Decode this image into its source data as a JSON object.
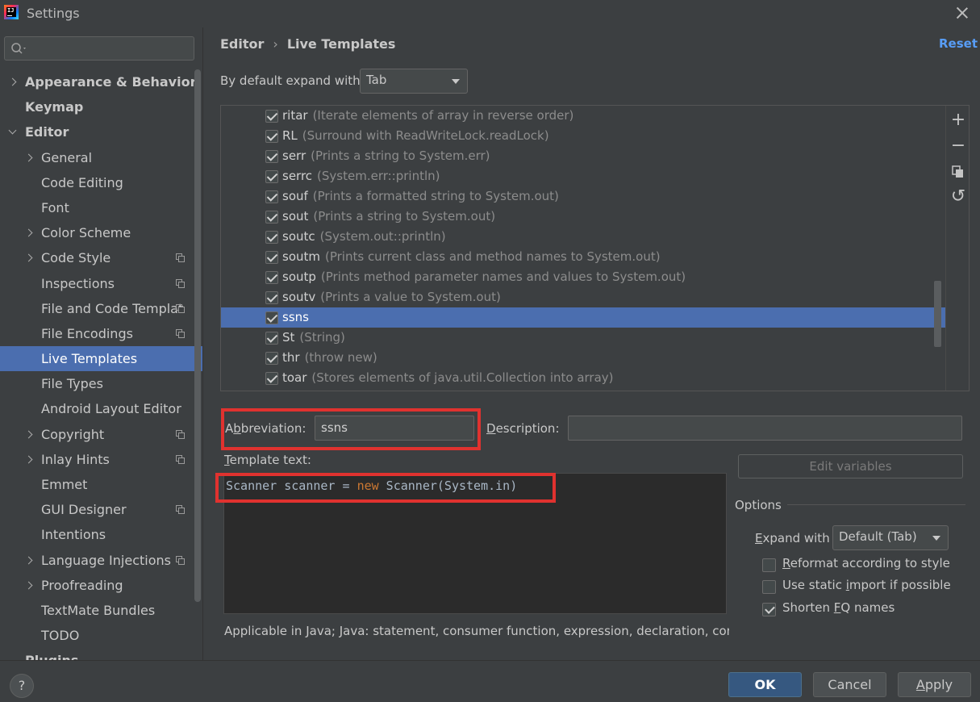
{
  "window": {
    "title": "Settings",
    "app_icon_text": "IJ"
  },
  "sidebar": {
    "search_placeholder": "",
    "items": [
      {
        "label": "Appearance & Behavior",
        "level": 0,
        "expandable": true,
        "expanded": false
      },
      {
        "label": "Keymap",
        "level": 0
      },
      {
        "label": "Editor",
        "level": 0,
        "expandable": true,
        "expanded": true
      },
      {
        "label": "General",
        "level": 1,
        "expandable": true
      },
      {
        "label": "Code Editing",
        "level": 1
      },
      {
        "label": "Font",
        "level": 1
      },
      {
        "label": "Color Scheme",
        "level": 1,
        "expandable": true
      },
      {
        "label": "Code Style",
        "level": 1,
        "expandable": true,
        "project_icon": true
      },
      {
        "label": "Inspections",
        "level": 1,
        "project_icon": true
      },
      {
        "label": "File and Code Templat",
        "level": 1,
        "project_icon": true
      },
      {
        "label": "File Encodings",
        "level": 1,
        "project_icon": true
      },
      {
        "label": "Live Templates",
        "level": 1,
        "selected": true
      },
      {
        "label": "File Types",
        "level": 1
      },
      {
        "label": "Android Layout Editor",
        "level": 1
      },
      {
        "label": "Copyright",
        "level": 1,
        "expandable": true,
        "project_icon": true
      },
      {
        "label": "Inlay Hints",
        "level": 1,
        "expandable": true,
        "project_icon": true
      },
      {
        "label": "Emmet",
        "level": 1
      },
      {
        "label": "GUI Designer",
        "level": 1,
        "project_icon": true
      },
      {
        "label": "Intentions",
        "level": 1
      },
      {
        "label": "Language Injections",
        "level": 1,
        "expandable": true,
        "project_icon": true
      },
      {
        "label": "Proofreading",
        "level": 1,
        "expandable": true
      },
      {
        "label": "TextMate Bundles",
        "level": 1
      },
      {
        "label": "TODO",
        "level": 1
      }
    ],
    "partial_item": "Plugins"
  },
  "breadcrumb": {
    "parent": "Editor",
    "separator": "›",
    "current": "Live Templates"
  },
  "reset_label": "Reset",
  "expand_with": {
    "label": "By default expand with",
    "value": "Tab"
  },
  "templates": [
    {
      "abbr": "ritar",
      "desc": "(Iterate elements of array in reverse order)",
      "checked": true
    },
    {
      "abbr": "RL",
      "desc": "(Surround with ReadWriteLock.readLock)",
      "checked": true
    },
    {
      "abbr": "serr",
      "desc": "(Prints a string to System.err)",
      "checked": true
    },
    {
      "abbr": "serrc",
      "desc": "(System.err::println)",
      "checked": true
    },
    {
      "abbr": "souf",
      "desc": "(Prints a formatted string to System.out)",
      "checked": true
    },
    {
      "abbr": "sout",
      "desc": "(Prints a string to System.out)",
      "checked": true
    },
    {
      "abbr": "soutc",
      "desc": "(System.out::println)",
      "checked": true
    },
    {
      "abbr": "soutm",
      "desc": "(Prints current class and method names to System.out)",
      "checked": true
    },
    {
      "abbr": "soutp",
      "desc": "(Prints method parameter names and values to System.out)",
      "checked": true
    },
    {
      "abbr": "soutv",
      "desc": "(Prints a value to System.out)",
      "checked": true
    },
    {
      "abbr": "ssns",
      "desc": "",
      "checked": true,
      "selected": true
    },
    {
      "abbr": "St",
      "desc": "(String)",
      "checked": true
    },
    {
      "abbr": "thr",
      "desc": "(throw new)",
      "checked": true
    },
    {
      "abbr": "toar",
      "desc": "(Stores elements of java.util.Collection into array)",
      "checked": true
    }
  ],
  "toolbar": {
    "add": "+",
    "remove": "−",
    "copy": "copy",
    "restore": "↺"
  },
  "abbreviation": {
    "label_pre": "A",
    "label_u": "b",
    "label_post": "breviation:",
    "value": "ssns"
  },
  "description": {
    "label_u": "D",
    "label_post": "escription:",
    "value": ""
  },
  "template_text": {
    "label_u": "T",
    "label_post": "emplate text:",
    "code_pre": "Scanner scanner = ",
    "code_kw": "new",
    "code_post": " Scanner(System.in)"
  },
  "edit_variables_label": "Edit variables",
  "options": {
    "title": "Options",
    "expand_with_label_u": "E",
    "expand_with_label_post": "xpand with",
    "expand_with_value": "Default (Tab)",
    "checkboxes": [
      {
        "label_pre": "",
        "label_u": "R",
        "label_post": "eformat according to style",
        "checked": false
      },
      {
        "label_pre": "Use static ",
        "label_u": "i",
        "label_post": "mport if possible",
        "checked": false
      },
      {
        "label_pre": "Shorten ",
        "label_u": "F",
        "label_post": "Q names",
        "checked": true
      }
    ]
  },
  "applicable_text": "Applicable in Java; Java: statement, consumer function, expression, declaration, comm",
  "footer": {
    "help": "?",
    "ok": "OK",
    "cancel": "Cancel",
    "apply_u": "A",
    "apply_post": "pply"
  },
  "colors": {
    "accent": "#4b6eaf",
    "highlight_box": "#e0322f",
    "link": "#589df6",
    "keyword": "#cc7832"
  }
}
